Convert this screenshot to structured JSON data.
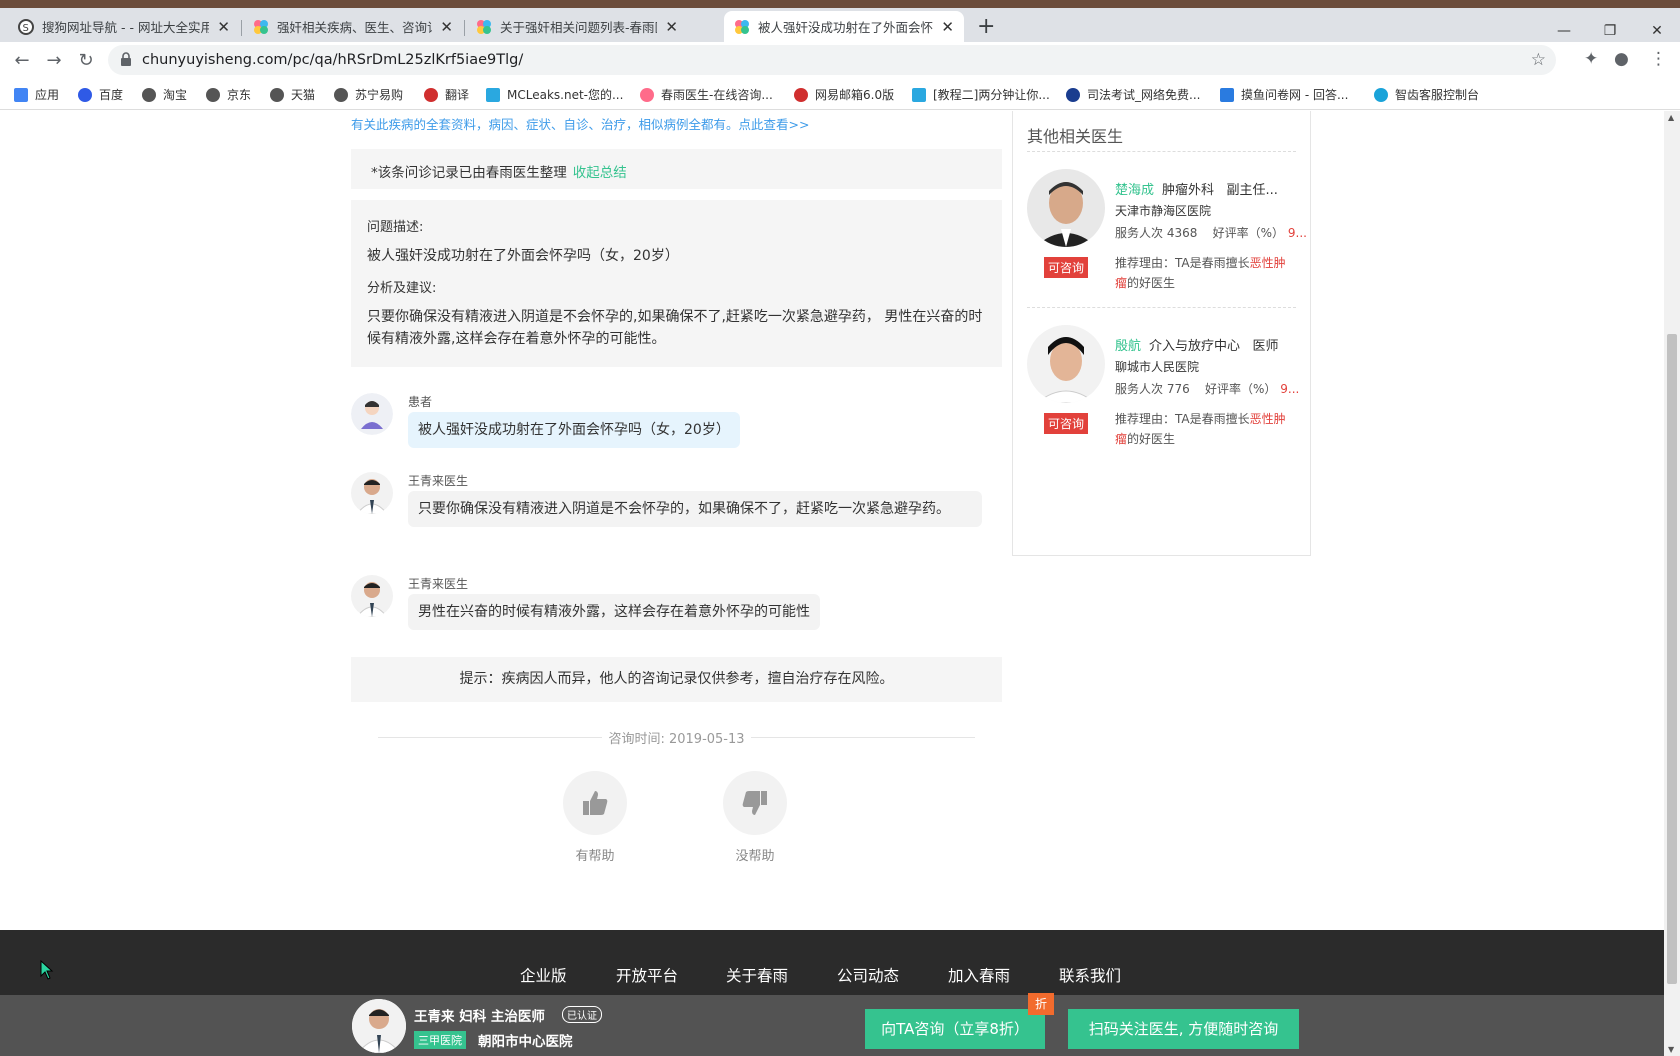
{
  "browser": {
    "tabs": [
      {
        "title": "搜狗网址导航 - - 网址大全实用",
        "active": false
      },
      {
        "title": "强奸相关疾病、医生、咨询记录",
        "active": false
      },
      {
        "title": "关于强奸相关问题列表-春雨医生",
        "active": false
      },
      {
        "title": "被人强奸没成功射在了外面会怀孕",
        "active": true
      }
    ],
    "url": "chunyuyisheng.com/pc/qa/hRSrDmL25zlKrf5iae9Tlg/",
    "bookmarks": [
      "应用",
      "百度",
      "淘宝",
      "京东",
      "天猫",
      "苏宁易购",
      "翻译",
      "MCLeaks.net-您的...",
      "春雨医生-在线咨询...",
      "网易邮箱6.0版",
      "[教程二]两分钟让你...",
      "司法考试_网络免费...",
      "摸鱼问卷网 - 回答...",
      "智齿客服控制台"
    ]
  },
  "page": {
    "top_link": "有关此疾病的全套资料，病因、症状、自诊、治疗，相似病例全都有。点此查看>>",
    "note": {
      "text": "*该条问诊记录已由春雨医生整理",
      "collapse": "收起总结"
    },
    "summary": {
      "question_label": "问题描述:",
      "question": "被人强奸没成功射在了外面会怀孕吗（女，20岁）",
      "advice_label": "分析及建议:",
      "advice": "只要你确保没有精液进入阴道是不会怀孕的,如果确保不了,赶紧吃一次紧急避孕药， 男性在兴奋的时候有精液外露,这样会存在着意外怀孕的可能性。"
    },
    "messages": [
      {
        "sender": "患者",
        "text": "被人强奸没成功射在了外面会怀孕吗（女，20岁）"
      },
      {
        "sender": "王青来医生",
        "text": "只要你确保没有精液进入阴道是不会怀孕的，如果确保不了，赶紧吃一次紧急避孕药。"
      },
      {
        "sender": "王青来医生",
        "text": "男性在兴奋的时候有精液外露，这样会存在着意外怀孕的可能性"
      }
    ],
    "tip": "提示：疾病因人而异，他人的咨询记录仅供参考，擅自治疗存在风险。",
    "time": "咨询时间: 2019-05-13",
    "helpful": "有帮助",
    "not_helpful": "没帮助"
  },
  "sidebar": {
    "title": "其他相关医生",
    "doctors": [
      {
        "name": "楚海成",
        "dept": "肿瘤外科",
        "title": "副主任...",
        "hospital": "天津市静海区医院",
        "stats_label": "服务人次",
        "served": "4368",
        "rate_label": "好评率（%）",
        "rate": "9...",
        "reason_prefix": "推荐理由：TA是春雨擅长",
        "reason_hl1": "恶性肿",
        "reason_hl2": "瘤",
        "reason_suffix": "的好医生",
        "consult": "可咨询"
      },
      {
        "name": "殷航",
        "dept": "介入与放疗中心",
        "title": "医师",
        "hospital": "聊城市人民医院",
        "stats_label": "服务人次",
        "served": "776",
        "rate_label": "好评率（%）",
        "rate": "9...",
        "reason_prefix": "推荐理由：TA是春雨擅长",
        "reason_hl1": "恶性肿",
        "reason_hl2": "瘤",
        "reason_suffix": "的好医生",
        "consult": "可咨询"
      }
    ]
  },
  "footer": {
    "links": [
      "企业版",
      "开放平台",
      "关于春雨",
      "公司动态",
      "加入春雨",
      "联系我们"
    ]
  },
  "bottombar": {
    "doctor": "王青来  妇科  主治医师",
    "verified": "已认证",
    "level": "三甲医院",
    "hospital": "朝阳市中心医院",
    "ask_button": "向TA咨询（立享8折）",
    "discount": "折",
    "follow_button": "扫码关注医生, 方便随时咨询"
  },
  "colors": {
    "accent": "#35c38f",
    "link": "#3d9be9",
    "alert": "#e2413b"
  }
}
